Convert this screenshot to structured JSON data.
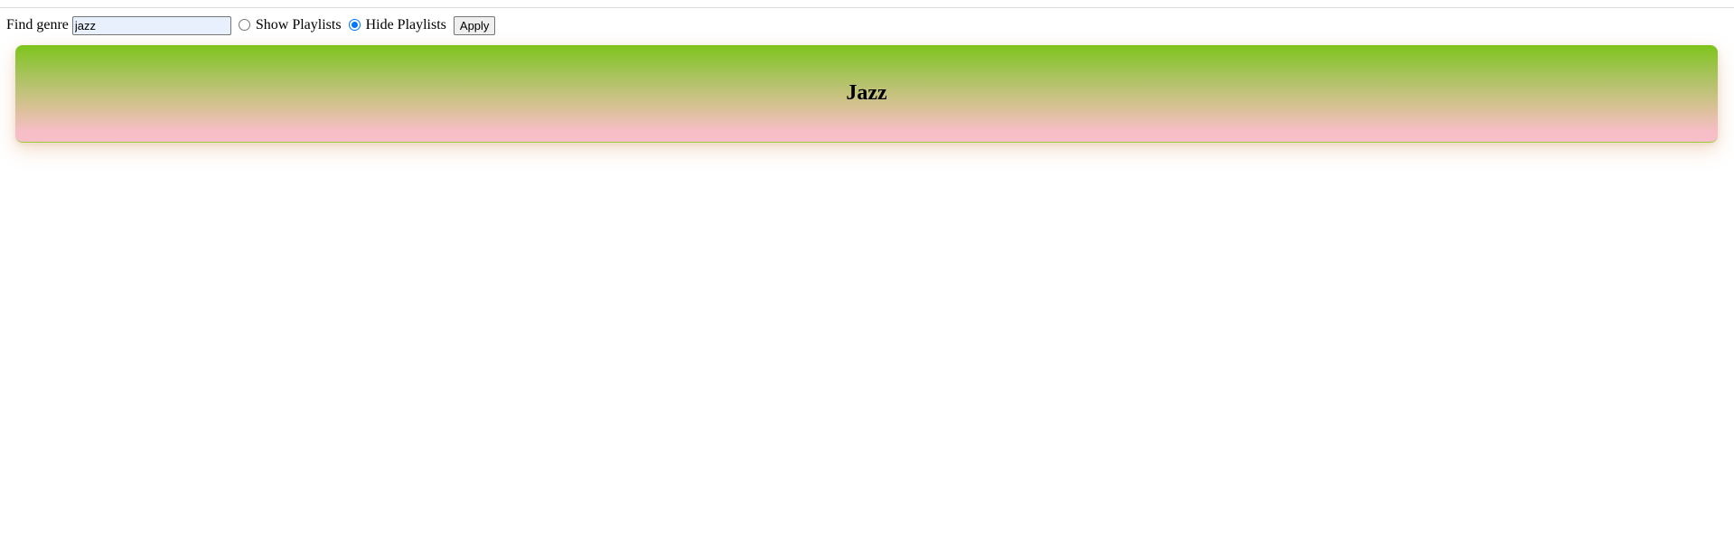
{
  "filter": {
    "label": "Find genre",
    "search_value": "jazz",
    "options": [
      {
        "label": "Show Playlists",
        "selected": false
      },
      {
        "label": "Hide Playlists",
        "selected": true
      }
    ],
    "apply_label": "Apply"
  },
  "genre_card": {
    "title": "Jazz",
    "gradient_colors": [
      "#7dc41c",
      "#f7bfc9"
    ]
  }
}
